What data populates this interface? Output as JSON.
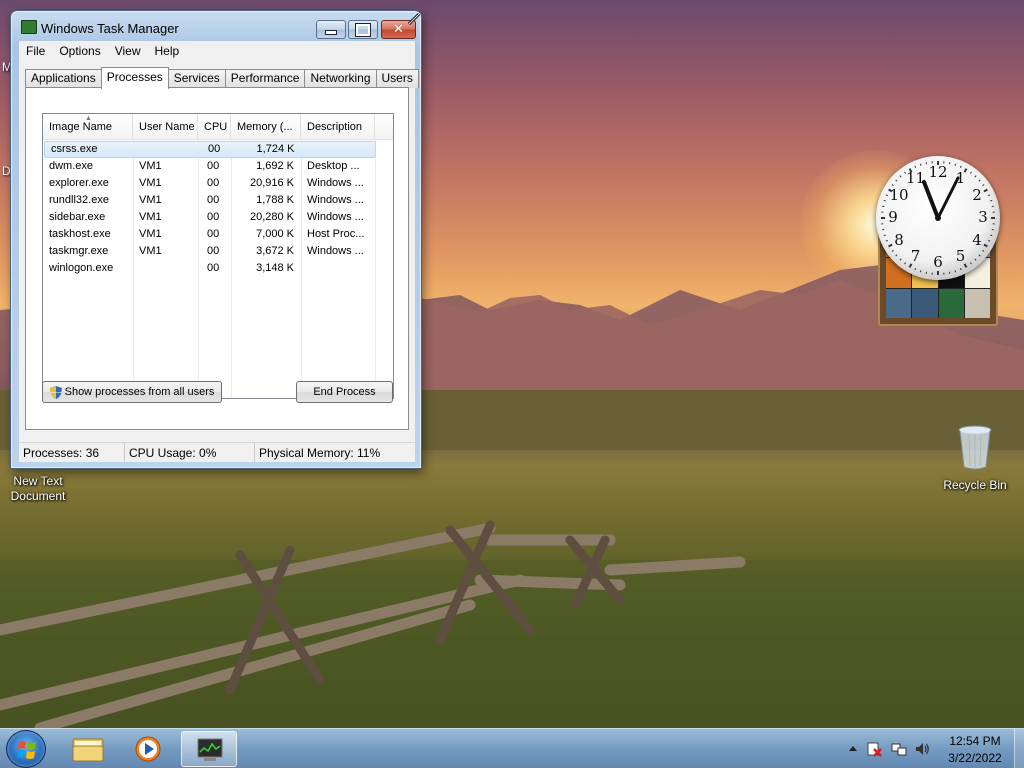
{
  "window": {
    "title": "Windows Task Manager",
    "menu": [
      "File",
      "Options",
      "View",
      "Help"
    ],
    "tabs": [
      {
        "label": "Applications",
        "active": false
      },
      {
        "label": "Processes",
        "active": true
      },
      {
        "label": "Services",
        "active": false
      },
      {
        "label": "Performance",
        "active": false
      },
      {
        "label": "Networking",
        "active": false
      },
      {
        "label": "Users",
        "active": false
      }
    ],
    "columns": [
      "Image Name",
      "User Name",
      "CPU",
      "Memory (...",
      "Description"
    ],
    "processes": [
      {
        "image": "csrss.exe",
        "user": "",
        "cpu": "00",
        "memory": "1,724 K",
        "description": "",
        "selected": true
      },
      {
        "image": "dwm.exe",
        "user": "VM1",
        "cpu": "00",
        "memory": "1,692 K",
        "description": "Desktop ..."
      },
      {
        "image": "explorer.exe",
        "user": "VM1",
        "cpu": "00",
        "memory": "20,916 K",
        "description": "Windows ..."
      },
      {
        "image": "rundll32.exe",
        "user": "VM1",
        "cpu": "00",
        "memory": "1,788 K",
        "description": "Windows ..."
      },
      {
        "image": "sidebar.exe",
        "user": "VM1",
        "cpu": "00",
        "memory": "20,280 K",
        "description": "Windows ..."
      },
      {
        "image": "taskhost.exe",
        "user": "VM1",
        "cpu": "00",
        "memory": "7,000 K",
        "description": "Host Proc..."
      },
      {
        "image": "taskmgr.exe",
        "user": "VM1",
        "cpu": "00",
        "memory": "3,672 K",
        "description": "Windows ..."
      },
      {
        "image": "winlogon.exe",
        "user": "",
        "cpu": "00",
        "memory": "3,148 K",
        "description": ""
      }
    ],
    "show_all_button": "Show processes from all users",
    "end_process_button": "End Process",
    "status": {
      "processes": "Processes: 36",
      "cpu": "CPU Usage: 0%",
      "memory": "Physical Memory: 11%"
    }
  },
  "desktop": {
    "icons": [
      {
        "label_line1": "New Text",
        "label_line2": "Document"
      },
      {
        "label": "Recycle Bin"
      }
    ],
    "partial_labels": [
      "M",
      "D"
    ]
  },
  "gadget": {
    "clock_numbers": [
      "12",
      "1",
      "2",
      "3",
      "4",
      "5",
      "6",
      "7",
      "8",
      "9",
      "10",
      "11"
    ],
    "photo_tile_colors": [
      "#c87828",
      "#e0a040",
      "#3a2a1a",
      "#b0b0a0",
      "#d07020",
      "#f0c050",
      "#101010",
      "#f4f0e0",
      "#4a6a8a",
      "#3a5a7a",
      "#2a6a3a",
      "#c8c0b0"
    ]
  },
  "taskbar": {
    "time": "12:54 PM",
    "date": "3/22/2022",
    "pinned": [
      "start-orb",
      "windows-explorer",
      "windows-media-player",
      "task-manager"
    ]
  },
  "colors": {
    "title_bar": "#a9c6e6",
    "selection": "#d7e8f9",
    "close_button": "#c04a32"
  }
}
